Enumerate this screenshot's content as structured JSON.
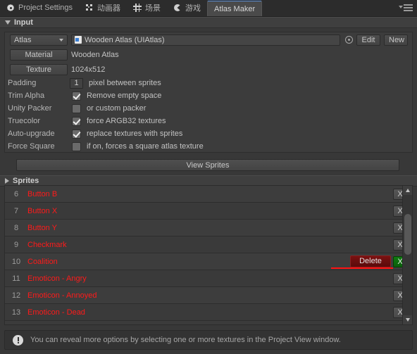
{
  "window": {
    "tabs": [
      {
        "label": "Project Settings",
        "icon": "gear-icon",
        "active": false
      },
      {
        "label": "动画器",
        "icon": "animator-icon",
        "active": false
      },
      {
        "label": "场景",
        "icon": "scene-grid-icon",
        "active": false
      },
      {
        "label": "游戏",
        "icon": "game-icon",
        "active": false
      },
      {
        "label": "Atlas Maker",
        "icon": "",
        "active": true
      }
    ],
    "menu_icon": "hamburger-menu-icon"
  },
  "input_section": {
    "title": "Input",
    "atlas_dropdown_label": "Atlas",
    "atlas_object_value": "Wooden Atlas (UIAtlas)",
    "atlas_object_icon": "unity-asset-icon",
    "picker_icon": "object-picker-icon",
    "edit_button": "Edit",
    "new_button": "New",
    "material_button_label": "Material",
    "material_value": "Wooden Atlas",
    "texture_button_label": "Texture",
    "texture_value": "1024x512",
    "padding_label": "Padding",
    "padding_value": "1",
    "padding_desc": "pixel between sprites",
    "rows": [
      {
        "label": "Trim Alpha",
        "checked": true,
        "desc": "Remove empty space"
      },
      {
        "label": "Unity Packer",
        "checked": false,
        "desc": "or custom packer"
      },
      {
        "label": "Truecolor",
        "checked": true,
        "desc": "force ARGB32 textures"
      },
      {
        "label": "Auto-upgrade",
        "checked": true,
        "desc": "replace textures with sprites"
      },
      {
        "label": "Force Square",
        "checked": false,
        "desc": "if on, forces a square atlas texture"
      }
    ]
  },
  "view_sprites_button": "View Sprites",
  "sprites_section": {
    "title": "Sprites",
    "delete_button_label": "Delete",
    "remove_button_label": "X",
    "rows": [
      {
        "index": "6",
        "name": "Button B",
        "selected": false
      },
      {
        "index": "7",
        "name": "Button X",
        "selected": false
      },
      {
        "index": "8",
        "name": "Button Y",
        "selected": false
      },
      {
        "index": "9",
        "name": "Checkmark",
        "selected": false
      },
      {
        "index": "10",
        "name": "Coalition",
        "selected": true
      },
      {
        "index": "11",
        "name": "Emoticon - Angry",
        "selected": false
      },
      {
        "index": "12",
        "name": "Emoticon - Annoyed",
        "selected": false
      },
      {
        "index": "13",
        "name": "Emoticon - Dead",
        "selected": false
      }
    ]
  },
  "help": {
    "icon": "info-icon",
    "text": "You can reveal more options by selecting one or more textures in the Project View window."
  },
  "colors": {
    "sprite_name": "#ff1a1a",
    "delete_button": "#7a1111",
    "confirm_button": "#0f7a10",
    "highlight_underline": "#ff1111",
    "active_tab_accent": "#5c8fd6"
  }
}
